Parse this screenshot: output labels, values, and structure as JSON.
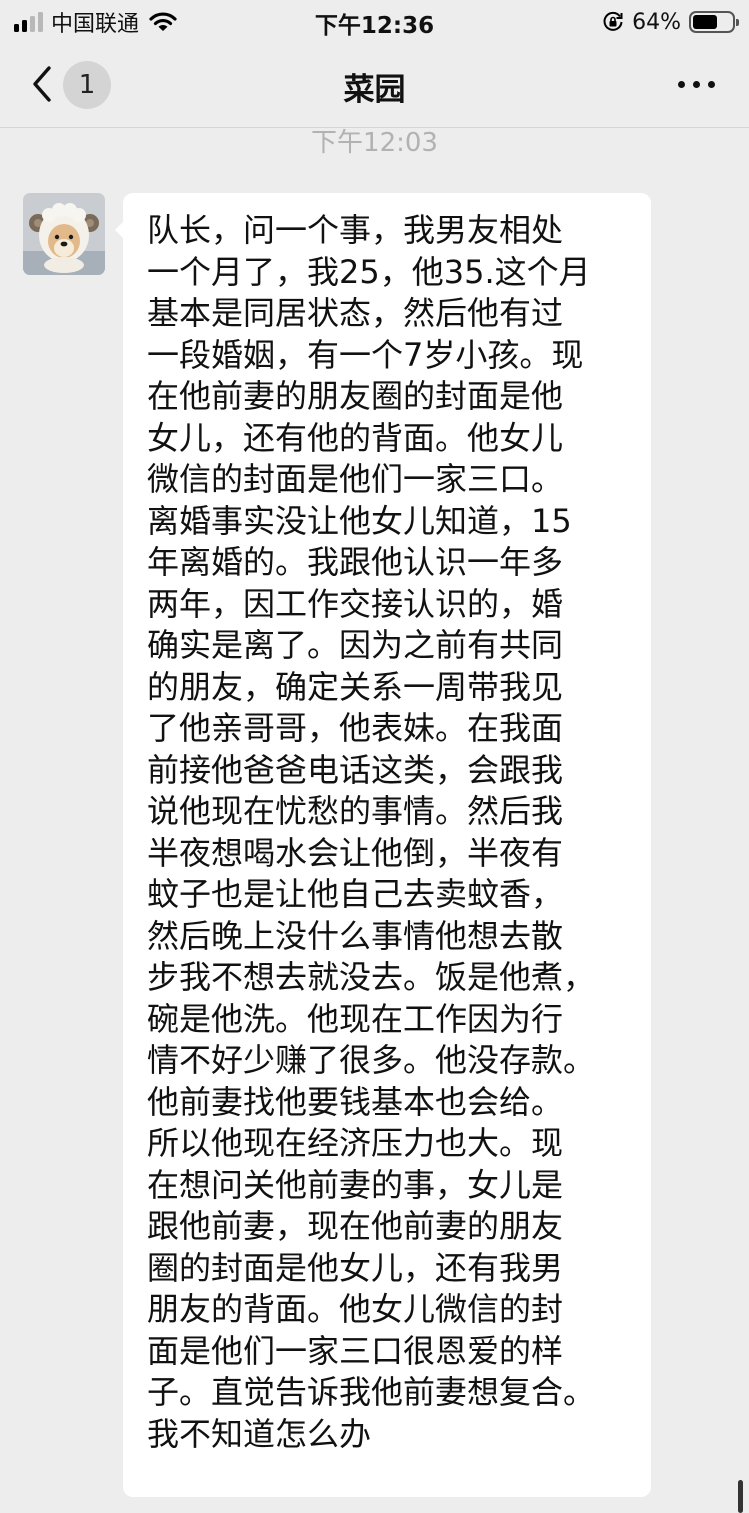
{
  "status_bar": {
    "carrier": "中国联通",
    "time": "下午12:36",
    "battery_percent": "64%",
    "battery_level": 0.64,
    "signal_bars": 4,
    "signal_bars_active": 2
  },
  "nav": {
    "title": "菜园",
    "unread_count": "1"
  },
  "chat": {
    "timestamp": "下午12:03",
    "messages": [
      {
        "lines": [
          "队长，问一个事，我男友相处",
          "一个月了，我25，他35.这个月",
          "基本是同居状态，然后他有过",
          "一段婚姻，有一个7岁小孩。现",
          "在他前妻的朋友圈的封面是他",
          "女儿，还有他的背面。他女儿",
          "微信的封面是他们一家三口。",
          "离婚事实没让他女儿知道，15",
          "年离婚的。我跟他认识一年多",
          "两年，因工作交接认识的，婚",
          "确实是离了。因为之前有共同",
          "的朋友，确定关系一周带我见",
          "了他亲哥哥，他表妹。在我面",
          "前接他爸爸电话这类，会跟我",
          "说他现在忧愁的事情。然后我",
          "半夜想喝水会让他倒，半夜有",
          "蚊子也是让他自己去卖蚊香，",
          "然后晚上没什么事情他想去散",
          "步我不想去就没去。饭是他煮，",
          "碗是他洗。他现在工作因为行",
          "情不好少赚了很多。他没存款。",
          "他前妻找他要钱基本也会给。",
          "所以他现在经济压力也大。现",
          "在想问关他前妻的事，女儿是",
          "跟他前妻，现在他前妻的朋友",
          "圈的封面是他女儿，还有我男",
          "朋友的背面。他女儿微信的封",
          "面是他们一家三口很恩爱的样",
          "子。直觉告诉我他前妻想复合。",
          "我不知道怎么办"
        ]
      }
    ]
  },
  "colors": {
    "background": "#ededed",
    "bubble": "#ffffff",
    "timestamp": "#b2b2b2",
    "badge": "#d4d4d4"
  },
  "icons": [
    "signal-icon",
    "wifi-icon",
    "orientation-lock-icon",
    "battery-icon",
    "back-chevron-icon",
    "more-options-icon",
    "sheep-dog-avatar"
  ]
}
